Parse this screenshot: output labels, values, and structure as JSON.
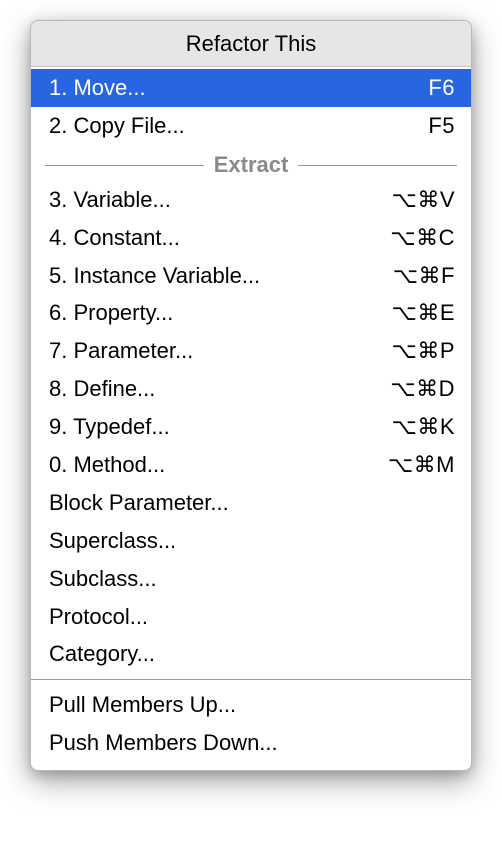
{
  "title": "Refactor This",
  "sections": {
    "top": [
      {
        "label": "1. Move...",
        "shortcut": "F6",
        "selected": true
      },
      {
        "label": "2. Copy File...",
        "shortcut": "F5",
        "selected": false
      }
    ],
    "extract_header": "Extract",
    "extract": [
      {
        "label": "3. Variable...",
        "shortcut": "⌥⌘V"
      },
      {
        "label": "4. Constant...",
        "shortcut": "⌥⌘C"
      },
      {
        "label": "5. Instance Variable...",
        "shortcut": "⌥⌘F"
      },
      {
        "label": "6. Property...",
        "shortcut": "⌥⌘E"
      },
      {
        "label": "7. Parameter...",
        "shortcut": "⌥⌘P"
      },
      {
        "label": "8. Define...",
        "shortcut": "⌥⌘D"
      },
      {
        "label": "9. Typedef...",
        "shortcut": "⌥⌘K"
      },
      {
        "label": "0. Method...",
        "shortcut": "⌥⌘M"
      },
      {
        "label": "Block Parameter...",
        "shortcut": ""
      },
      {
        "label": "Superclass...",
        "shortcut": ""
      },
      {
        "label": "Subclass...",
        "shortcut": ""
      },
      {
        "label": "Protocol...",
        "shortcut": ""
      },
      {
        "label": "Category...",
        "shortcut": ""
      }
    ],
    "bottom": [
      {
        "label": "Pull Members Up...",
        "shortcut": ""
      },
      {
        "label": "Push Members Down...",
        "shortcut": ""
      }
    ]
  }
}
